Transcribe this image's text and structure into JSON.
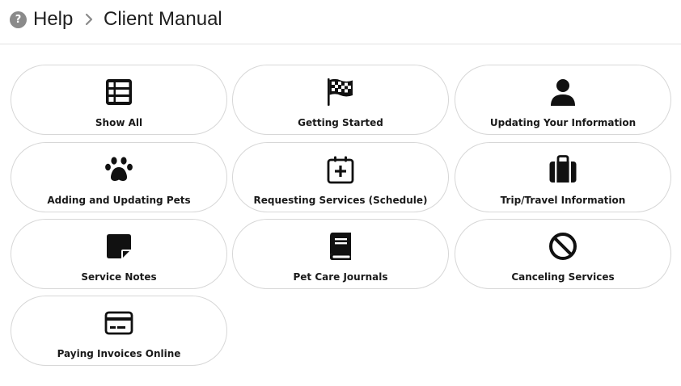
{
  "header": {
    "help_icon_glyph": "?",
    "root": "Help",
    "current": "Client Manual"
  },
  "topics": [
    {
      "label": "Show All",
      "icon": "table-list-icon"
    },
    {
      "label": "Getting Started",
      "icon": "checkered-flag-icon"
    },
    {
      "label": "Updating Your Information",
      "icon": "user-icon"
    },
    {
      "label": "Adding and Updating Pets",
      "icon": "paw-icon"
    },
    {
      "label": "Requesting Services (Schedule)",
      "icon": "calendar-plus-icon"
    },
    {
      "label": "Trip/Travel Information",
      "icon": "suitcase-icon"
    },
    {
      "label": "Service Notes",
      "icon": "sticky-note-icon"
    },
    {
      "label": "Pet Care Journals",
      "icon": "book-icon"
    },
    {
      "label": "Canceling Services",
      "icon": "ban-icon"
    },
    {
      "label": "Paying Invoices Online",
      "icon": "credit-card-icon"
    }
  ]
}
